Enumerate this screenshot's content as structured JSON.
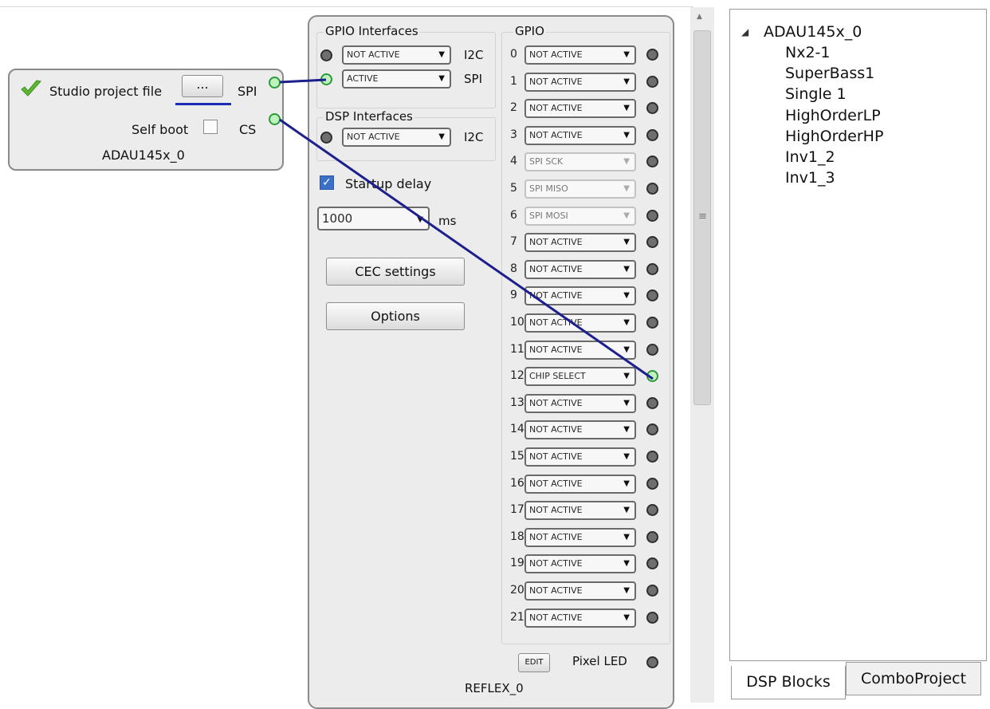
{
  "adau_block": {
    "project_file_label": "Studio project file",
    "browse_button_label": "...",
    "self_boot_label": "Self boot",
    "port_spi": "SPI",
    "port_cs": "CS",
    "name": "ADAU145x_0",
    "status_icon": "check-icon"
  },
  "reflex_panel": {
    "name": "REFLEX_0",
    "gpio_interfaces": {
      "title": "GPIO Interfaces",
      "rows": [
        {
          "value": "NOT ACTIVE",
          "type": "I2C",
          "led": "off"
        },
        {
          "value": "ACTIVE",
          "type": "SPI",
          "led": "on"
        }
      ]
    },
    "dsp_interfaces": {
      "title": "DSP Interfaces",
      "rows": [
        {
          "value": "NOT ACTIVE",
          "type": "I2C",
          "led": "off"
        }
      ]
    },
    "startup_delay": {
      "label": "Startup delay",
      "checked": true,
      "value": "1000",
      "unit": "ms"
    },
    "cec_button_label": "CEC settings",
    "options_button_label": "Options",
    "gpio": {
      "title": "GPIO",
      "rows": [
        {
          "num": "0",
          "value": "NOT ACTIVE"
        },
        {
          "num": "1",
          "value": "NOT ACTIVE"
        },
        {
          "num": "2",
          "value": "NOT ACTIVE"
        },
        {
          "num": "3",
          "value": "NOT ACTIVE"
        },
        {
          "num": "4",
          "value": "SPI SCK",
          "disabled": true
        },
        {
          "num": "5",
          "value": "SPI MISO",
          "disabled": true
        },
        {
          "num": "6",
          "value": "SPI MOSI",
          "disabled": true
        },
        {
          "num": "7",
          "value": "NOT ACTIVE"
        },
        {
          "num": "8",
          "value": "NOT ACTIVE"
        },
        {
          "num": "9",
          "value": "NOT ACTIVE"
        },
        {
          "num": "10",
          "value": "NOT ACTIVE"
        },
        {
          "num": "11",
          "value": "NOT ACTIVE"
        },
        {
          "num": "12",
          "value": "CHIP SELECT",
          "led": "on"
        },
        {
          "num": "13",
          "value": "NOT ACTIVE"
        },
        {
          "num": "14",
          "value": "NOT ACTIVE"
        },
        {
          "num": "15",
          "value": "NOT ACTIVE"
        },
        {
          "num": "16",
          "value": "NOT ACTIVE"
        },
        {
          "num": "17",
          "value": "NOT ACTIVE"
        },
        {
          "num": "18",
          "value": "NOT ACTIVE"
        },
        {
          "num": "19",
          "value": "NOT ACTIVE"
        },
        {
          "num": "20",
          "value": "NOT ACTIVE"
        },
        {
          "num": "21",
          "value": "NOT ACTIVE"
        }
      ]
    },
    "edit_button_label": "EDIT",
    "pixel_led_label": "Pixel LED"
  },
  "tree": {
    "root": "ADAU145x_0",
    "children": [
      "Nx2-1",
      "SuperBass1",
      "Single 1",
      "HighOrderLP",
      "HighOrderHP",
      "Inv1_2",
      "Inv1_3"
    ]
  },
  "tabs": [
    "DSP Blocks",
    "ComboProject"
  ],
  "colors": {
    "wire": "#1c1f8c",
    "led_on": "#bff3bd",
    "led_off": "#6f6f6f",
    "check_green": "#5fb832"
  }
}
